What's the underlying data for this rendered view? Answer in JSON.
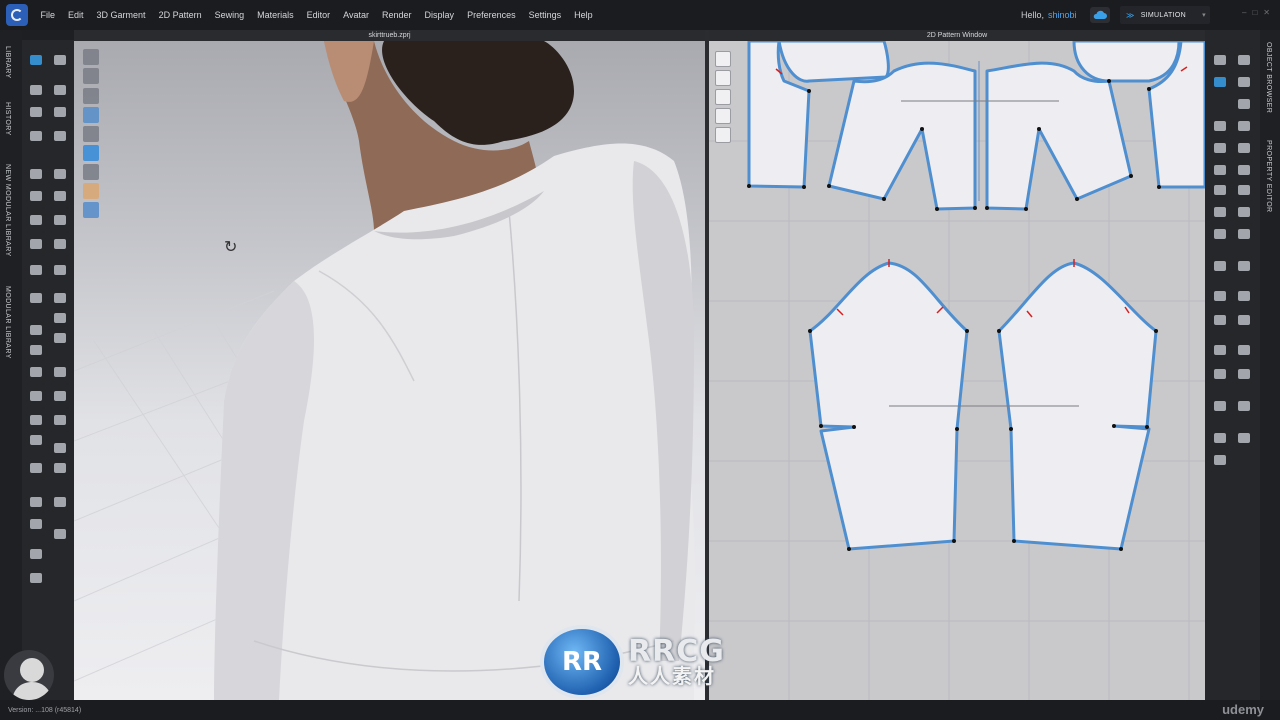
{
  "menubar": {
    "items": [
      "File",
      "Edit",
      "3D Garment",
      "2D Pattern",
      "Sewing",
      "Materials",
      "Editor",
      "Avatar",
      "Render",
      "Display",
      "Preferences",
      "Settings",
      "Help"
    ],
    "hello": "Hello,",
    "user": "shinobi",
    "mode_label": "SIMULATION"
  },
  "left_tabs": [
    "LIBRARY",
    "HISTORY",
    "NEW MODULAR LIBRARY",
    "MODULAR LIBRARY"
  ],
  "right_tabs": [
    "OBJECT BROWSER",
    "PROPERTY EDITOR"
  ],
  "viewport3d": {
    "title": "skirttrueb.zprj"
  },
  "viewport2d": {
    "title": "2D Pattern Window"
  },
  "status": {
    "text": "Version: ...108 (r45814)"
  },
  "watermark": {
    "badge": "RR",
    "big": "RRCG",
    "small": "人人素材"
  },
  "brand": "udemy",
  "colors": {
    "accent": "#3aa0e8",
    "user_name": "#4fa6f0",
    "pattern_outline": "#4f8fd0",
    "pattern_fill": "#eeeef2",
    "notch": "#d62020"
  }
}
